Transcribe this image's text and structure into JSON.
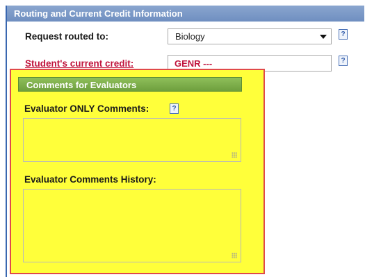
{
  "section": {
    "title": "Routing and Current Credit Information"
  },
  "routing": {
    "request_label": "Request routed to:",
    "request_value": "Biology",
    "credit_label": "Student's current credit:",
    "credit_value": "GENR ---"
  },
  "help": {
    "glyph": "?"
  },
  "evaluators": {
    "header": "Comments for Evaluators",
    "only_label": "Evaluator ONLY Comments:",
    "history_label": "Evaluator Comments History:",
    "only_text": "",
    "history_text": ""
  },
  "colors": {
    "section_header": "#7f9cc9",
    "sub_header": "#7aa84a",
    "highlight": "#ffff3a",
    "highlight_border": "#e04a4a",
    "credit_text": "#c0143c"
  },
  "icons": [
    "help-icon",
    "dropdown-arrow-icon",
    "resize-grip-icon"
  ]
}
